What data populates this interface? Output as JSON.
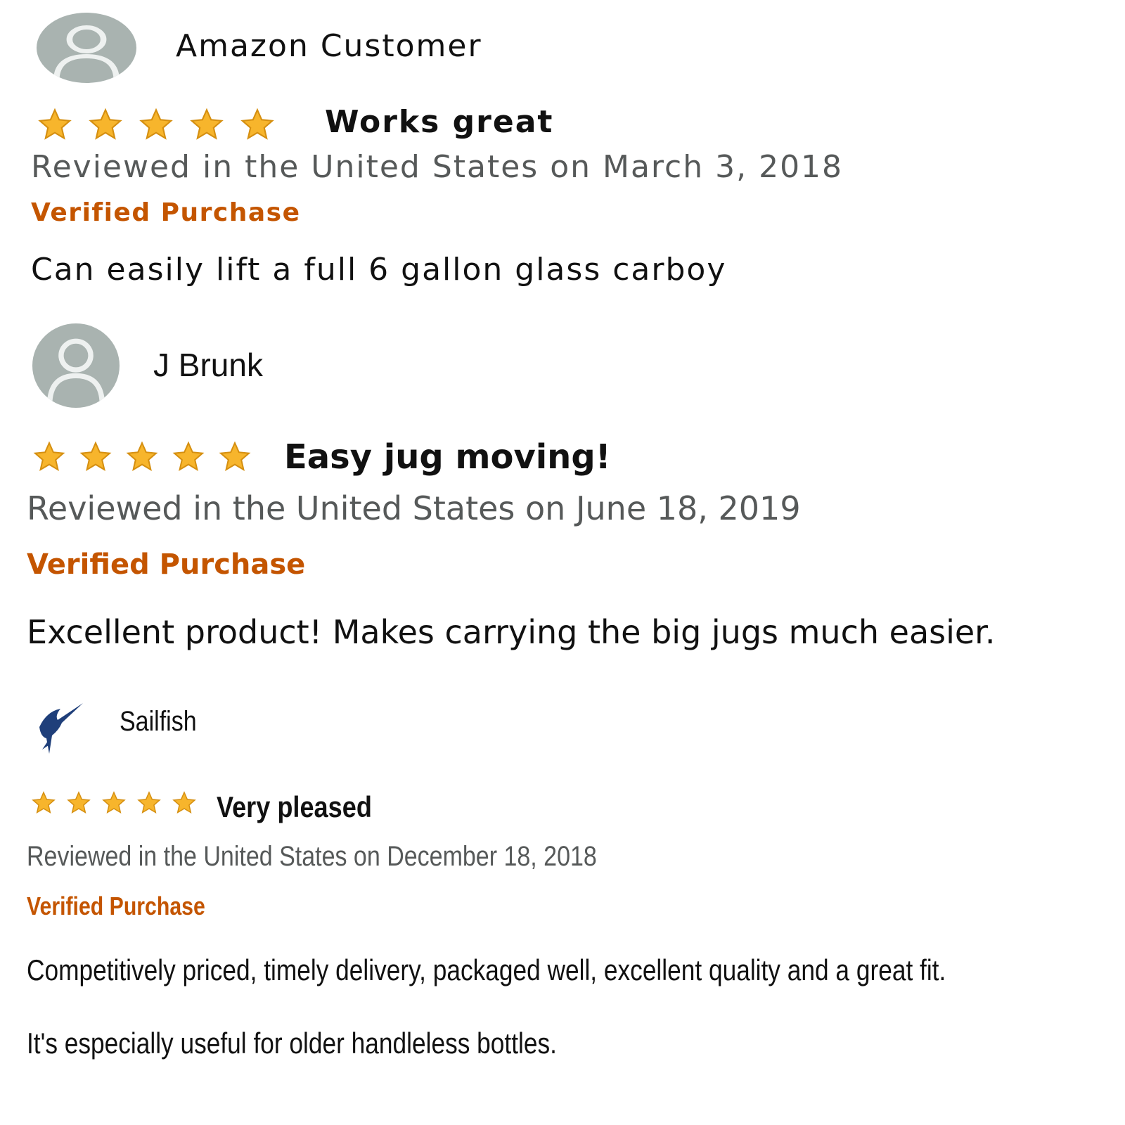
{
  "colors": {
    "star_fill": "#f7b52c",
    "star_stroke": "#d58f10",
    "verified": "#c45500",
    "date": "#565959",
    "avatar_bg": "#a9b3b0",
    "fish": "#1f3f7a"
  },
  "reviews": [
    {
      "reviewer": "Amazon Customer",
      "avatar_icon": "default-user-avatar-icon",
      "rating": 5,
      "title": "Works great",
      "date_line": "Reviewed in the United States on March 3, 2018",
      "verified_label": "Verified Purchase",
      "body": [
        "Can easily lift a full 6 gallon glass carboy"
      ]
    },
    {
      "reviewer": "J Brunk",
      "avatar_icon": "default-user-avatar-icon",
      "rating": 5,
      "title": "Easy jug moving!",
      "date_line": "Reviewed in the United States on June 18, 2019",
      "verified_label": "Verified Purchase",
      "body": [
        "Excellent product! Makes carrying the big jugs much easier."
      ]
    },
    {
      "reviewer": "Sailfish",
      "avatar_icon": "sailfish-icon",
      "rating": 5,
      "title": "Very pleased",
      "date_line": "Reviewed in the United States on December 18, 2018",
      "verified_label": "Verified Purchase",
      "body": [
        "Competitively priced, timely delivery, packaged well, excellent quality and a great fit.",
        "It's especially useful for older handleless bottles."
      ]
    }
  ]
}
